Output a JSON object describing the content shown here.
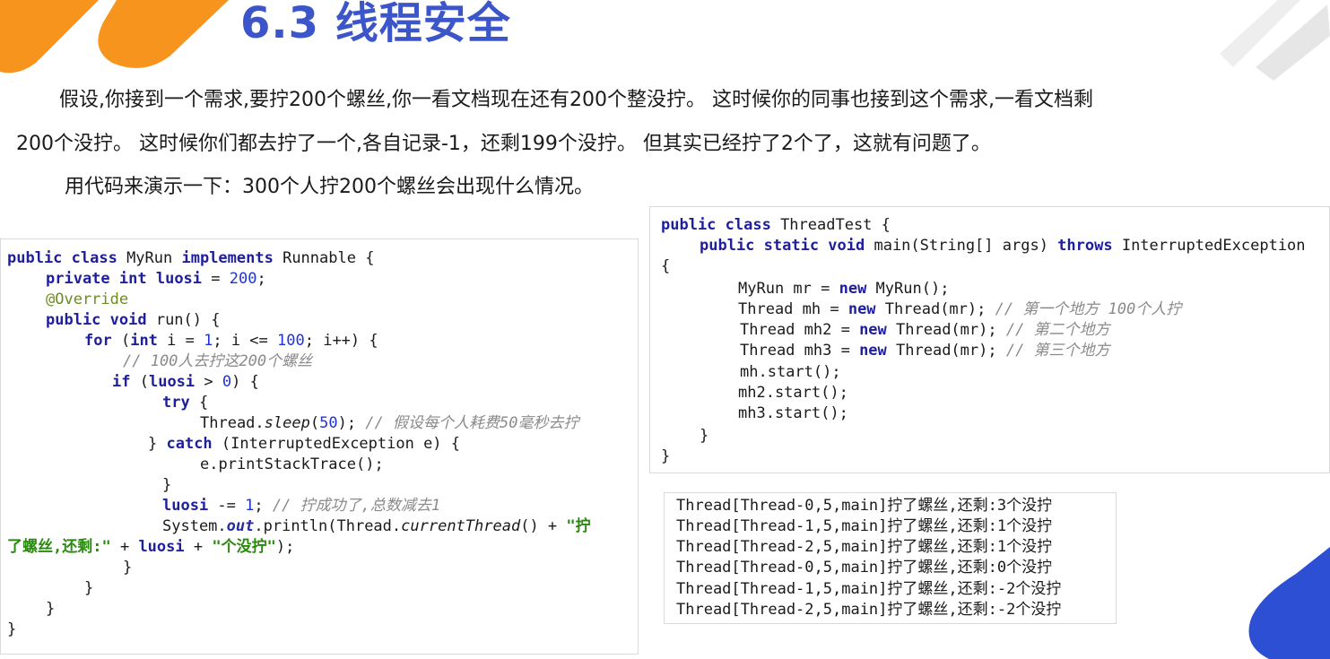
{
  "slide": {
    "title": "6.3 线程安全",
    "para1_line1": "假设,你接到一个需求,要拧200个螺丝,你一看文档现在还有200个整没拧。 这时候你的同事也接到这个需求,一看文档剩",
    "para1_line2": "200个没拧。 这时候你们都去拧了一个,各自记录-1，还剩199个没拧。 但其实已经拧了2个了，这就有问题了。",
    "para2": "用代码来演示一下：300个人拧200个螺丝会出现什么情况。"
  },
  "colors": {
    "title": "#3c56c9",
    "deco_orange": "#f7941d",
    "deco_blue": "#2c4fd4",
    "deco_grey": "#ececec"
  },
  "left_code": {
    "l1_kw1": "public class",
    "l1_name": " MyRun ",
    "l1_kw2": "implements",
    "l1_tail": " Runnable {",
    "l2_kw": "private int",
    "l2_sp": " ",
    "l2_fld": "luosi",
    "l2_eq": " = ",
    "l2_num": "200",
    "l2_end": ";",
    "l3_ann": "@Override",
    "l4_kw": "public void",
    "l4_tail": " run() {",
    "l5_kw": "for",
    "l5_a": " (",
    "l5_kw2": "int",
    "l5_b": " i = ",
    "l5_n1": "1",
    "l5_c": "; i <= ",
    "l5_n2": "100",
    "l5_d": "; i++) {",
    "l6_cmt": "// 100人去拧这200个螺丝",
    "l7_kw": "if",
    "l7_a": " (",
    "l7_fld": "luosi",
    "l7_b": " > ",
    "l7_n": "0",
    "l7_c": ") {",
    "l8_kw": "try",
    "l8_tail": " {",
    "l9_a": "Thread.",
    "l9_it": "sleep",
    "l9_b": "(",
    "l9_n": "50",
    "l9_c": "); ",
    "l9_cmt": "// 假设每个人耗费50毫秒去拧",
    "l10_a": "} ",
    "l10_kw": "catch",
    "l10_tail": " (InterruptedException e) {",
    "l11": "e.printStackTrace();",
    "l12": "}",
    "l13_fld": "luosi",
    "l13_a": " -= ",
    "l13_n": "1",
    "l13_b": "; ",
    "l13_cmt": "// 拧成功了,总数减去1",
    "l14_a": "System.",
    "l14_st": "out",
    "l14_b": ".println(Thread.",
    "l14_it": "currentThread",
    "l14_c": "() + ",
    "l14_str": "\"拧",
    "l15_str": "了螺丝,还剩:\"",
    "l15_a": " + ",
    "l15_fld": "luosi",
    "l15_b": " + ",
    "l15_str2": "\"个没拧\"",
    "l15_c": ");",
    "l16": "}",
    "l17": "}",
    "l18": "}",
    "l19": "}"
  },
  "right_code": {
    "r1_kw": "public class",
    "r1_tail": " ThreadTest {",
    "r2_kw": "public static void",
    "r2_a": " main(String[] args) ",
    "r2_kw2": "throws",
    "r2_b": " InterruptedException",
    "r3": "{",
    "r4_a": "MyRun mr = ",
    "r4_kw": "new",
    "r4_b": " MyRun();",
    "r5_a": "Thread mh = ",
    "r5_kw": "new",
    "r5_b": " Thread(mr); ",
    "r5_cmt": "// 第一个地方 100个人拧",
    "r6_a": "Thread mh2 = ",
    "r6_kw": "new",
    "r6_b": " Thread(mr); ",
    "r6_cmt": "// 第二个地方",
    "r7_a": "Thread mh3 = ",
    "r7_kw": "new",
    "r7_b": " Thread(mr); ",
    "r7_cmt": "// 第三个地方",
    "r8": "mh.start();",
    "r9": "mh2.start();",
    "r10": "mh3.start();",
    "r11": "}",
    "r12": "}"
  },
  "output": {
    "lines": [
      "Thread[Thread-0,5,main]拧了螺丝,还剩:3个没拧",
      "Thread[Thread-1,5,main]拧了螺丝,还剩:1个没拧",
      "Thread[Thread-2,5,main]拧了螺丝,还剩:1个没拧",
      "Thread[Thread-0,5,main]拧了螺丝,还剩:0个没拧",
      "Thread[Thread-1,5,main]拧了螺丝,还剩:-2个没拧",
      "Thread[Thread-2,5,main]拧了螺丝,还剩:-2个没拧"
    ]
  }
}
